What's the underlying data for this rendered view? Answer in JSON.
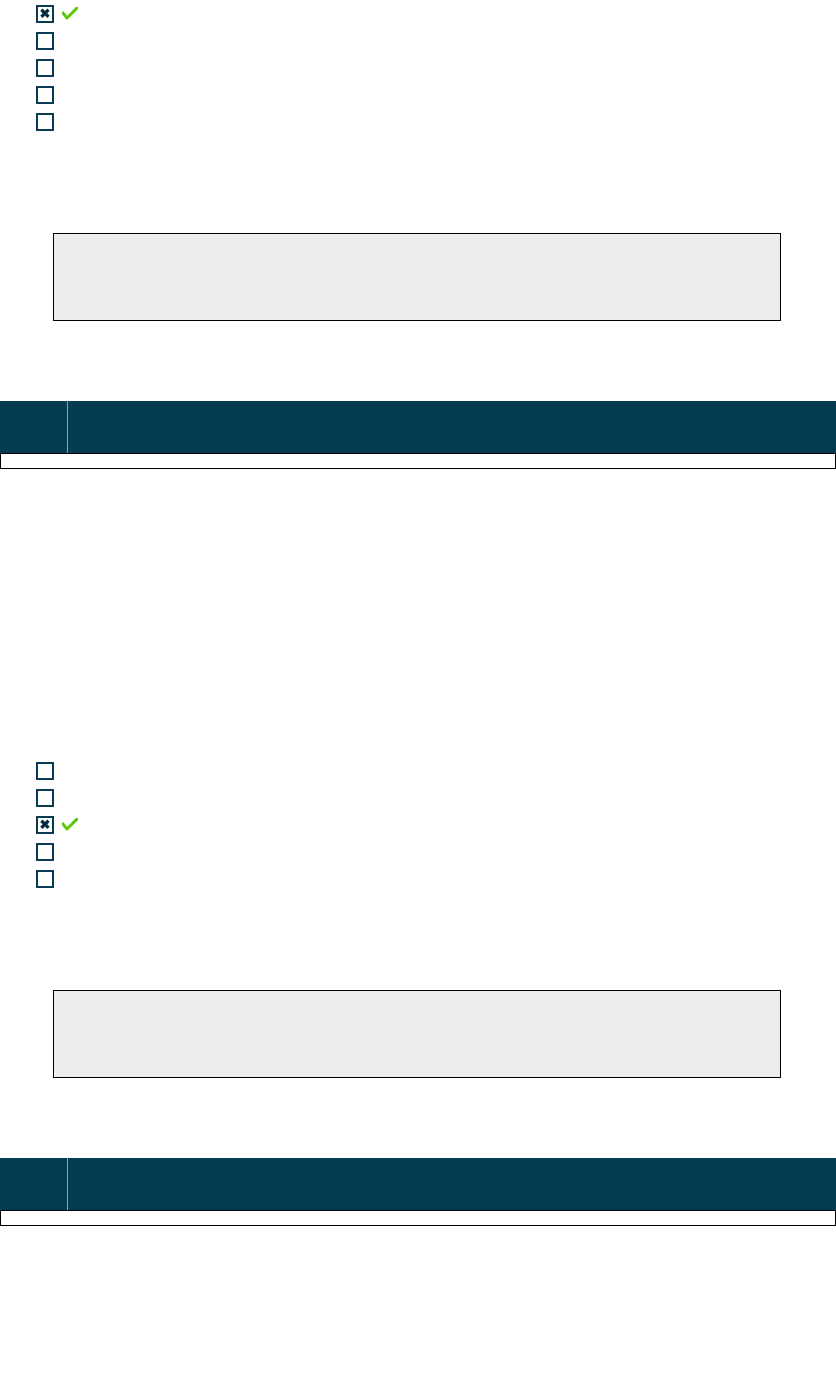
{
  "q1": {
    "options": [
      {
        "checked": true,
        "correct": true
      },
      {
        "checked": false,
        "correct": false
      },
      {
        "checked": false,
        "correct": false
      },
      {
        "checked": false,
        "correct": false
      },
      {
        "checked": false,
        "correct": false
      }
    ]
  },
  "q2": {
    "options": [
      {
        "checked": false,
        "correct": false
      },
      {
        "checked": false,
        "correct": false
      },
      {
        "checked": true,
        "correct": true
      },
      {
        "checked": false,
        "correct": false
      },
      {
        "checked": false,
        "correct": false
      }
    ]
  }
}
